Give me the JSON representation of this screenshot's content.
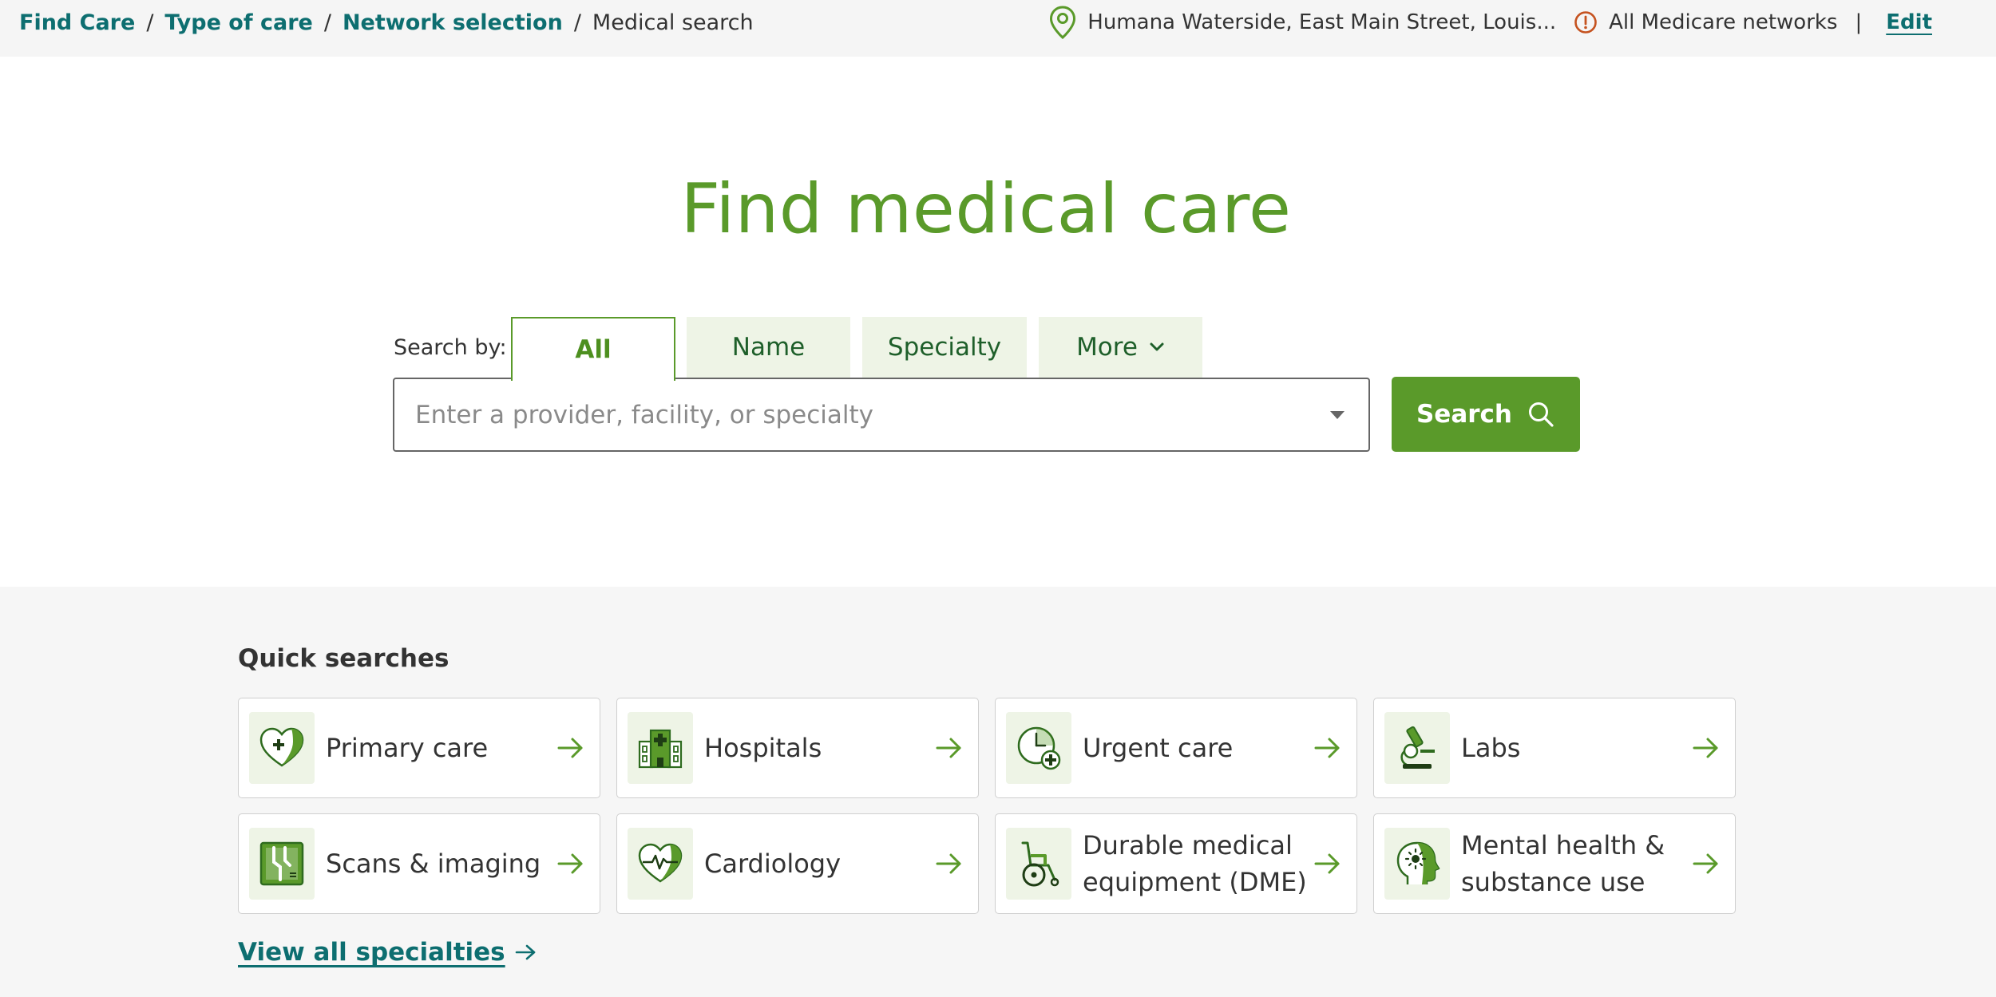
{
  "breadcrumb": {
    "items": [
      "Find Care",
      "Type of care",
      "Network selection"
    ],
    "separator": "/",
    "current": "Medical search"
  },
  "location": {
    "address": "Humana Waterside, East Main Street, Louis...",
    "networks": "All Medicare networks",
    "separator": "|",
    "edit_label": "Edit"
  },
  "hero": {
    "title": "Find medical care"
  },
  "search": {
    "label": "Search by:",
    "tabs": [
      "All",
      "Name",
      "Specialty",
      "More"
    ],
    "active_tab": "All",
    "placeholder": "Enter a provider, facility, or specialty",
    "value": "",
    "button_label": "Search"
  },
  "quick_searches": {
    "title": "Quick searches",
    "items": [
      {
        "label": "Primary care",
        "icon": "heart-plus-icon"
      },
      {
        "label": "Hospitals",
        "icon": "hospital-icon"
      },
      {
        "label": "Urgent care",
        "icon": "clock-plus-icon"
      },
      {
        "label": "Labs",
        "icon": "microscope-icon"
      },
      {
        "label": "Scans & imaging",
        "icon": "xray-icon"
      },
      {
        "label": "Cardiology",
        "icon": "heartbeat-icon"
      },
      {
        "label": "Durable medical equipment (DME)",
        "icon": "wheelchair-icon"
      },
      {
        "label": "Mental health & substance use",
        "icon": "head-icon"
      }
    ],
    "view_all_label": "View all specialties"
  },
  "colors": {
    "brand_green": "#5a9a2a",
    "link_teal": "#0d6e70",
    "tab_bg": "#eef4e6",
    "warning": "#c5521f"
  }
}
